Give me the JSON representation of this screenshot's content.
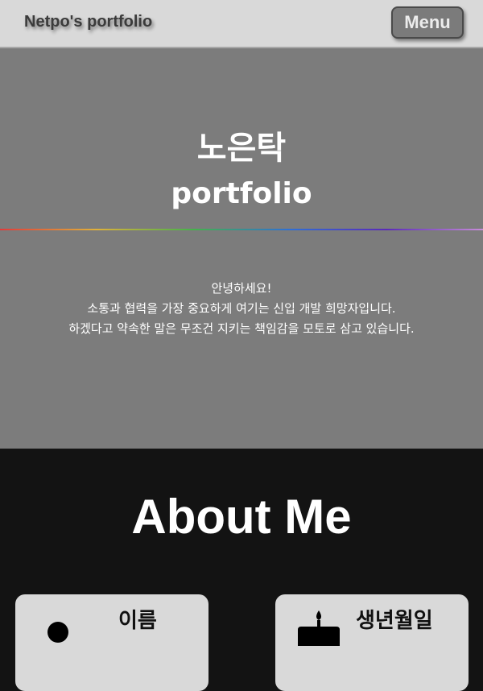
{
  "navbar": {
    "brand": "Netpo's portfolio",
    "menu_label": "Menu"
  },
  "hero": {
    "name": "노은탁",
    "subtitle": "portfolio",
    "intro_lines": [
      "안녕하세요!",
      "소통과 협력을 가장 중요하게 여기는 신입 개발 희망자입니다.",
      "하겠다고 약속한 말은 무조건 지키는 책임감을 모토로 삼고 있습니다."
    ]
  },
  "about": {
    "title": "About Me",
    "cards": [
      {
        "label": "이름",
        "icon": "person-icon"
      },
      {
        "label": "생년월일",
        "icon": "birthday-cake-icon"
      }
    ]
  },
  "colors": {
    "navbar_bg": "#d9d9d9",
    "hero_bg": "#7c7c7c",
    "about_bg": "#131313",
    "card_bg": "#d9d9d9"
  }
}
